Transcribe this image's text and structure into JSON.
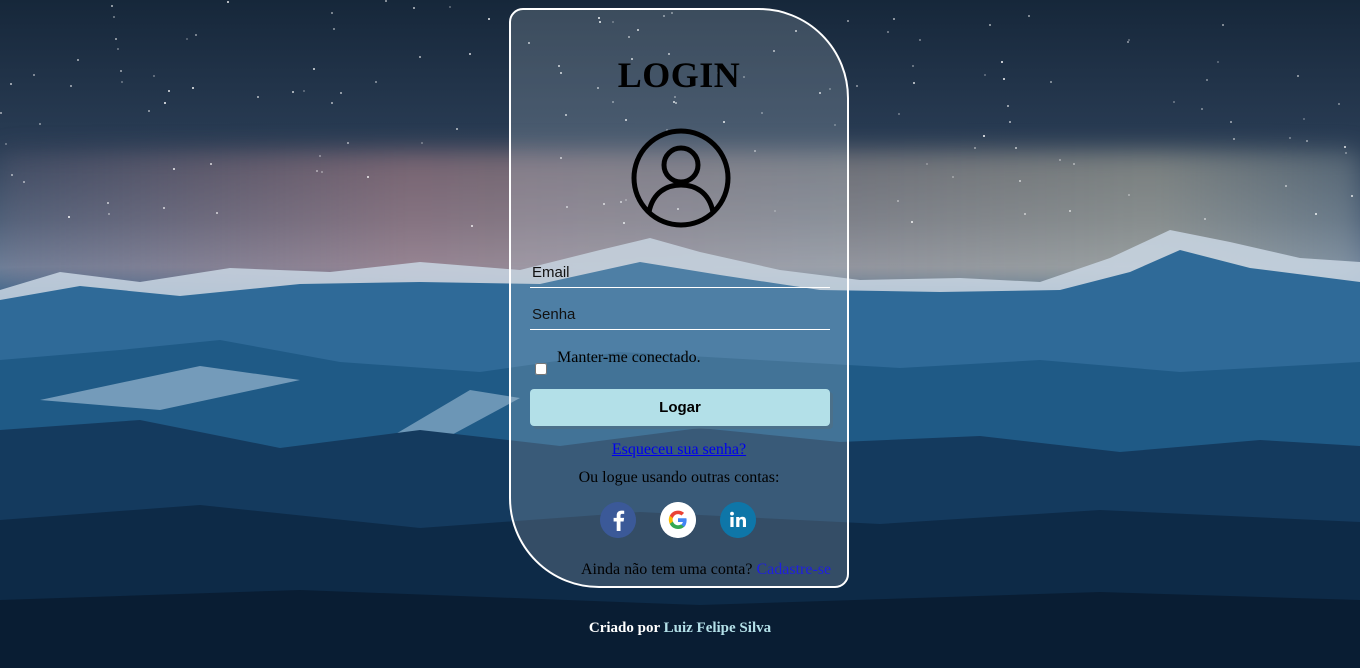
{
  "login": {
    "title": "LOGIN",
    "email_placeholder": "Email",
    "password_placeholder": "Senha",
    "remember_label": "Manter-me conectado.",
    "submit_label": "Logar",
    "forgot_link": "Esqueceu sua senha?",
    "other_accounts_text": "Ou logue usando outras contas:",
    "social": [
      "facebook-icon",
      "google-icon",
      "linkedin-icon"
    ],
    "signup_prompt": "Ainda não tem uma conta?",
    "signup_link": "Cadastre-se"
  },
  "footer": {
    "prefix": "Criado por",
    "author": "Luiz Felipe Silva"
  },
  "colors": {
    "button": "#b3e0e8",
    "link": "#0000ee",
    "author": "#b3e0e8",
    "facebook": "#3b5998",
    "linkedin": "#0e76a8"
  }
}
